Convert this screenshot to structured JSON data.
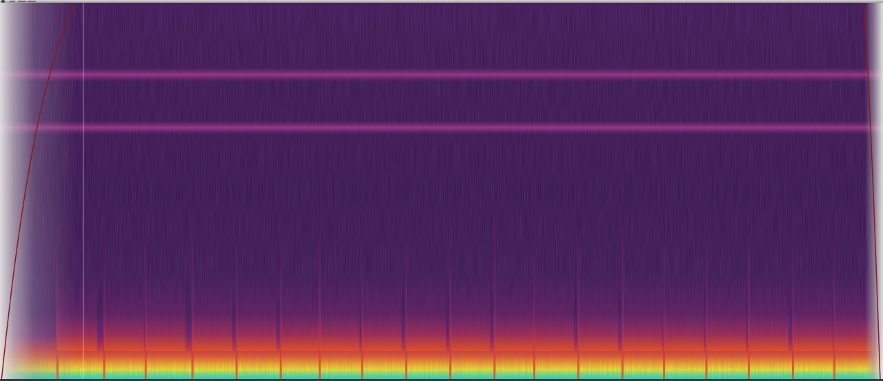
{
  "view": {
    "type": "spectrogram",
    "colormap": [
      "#2a1240",
      "#5a1f6e",
      "#a8306a",
      "#e0502a",
      "#f5b020",
      "#f2f020",
      "#40f0a0",
      "#30c0ff"
    ],
    "accent_curve_color": "#8a1a1a",
    "playhead_color": "#ffe6ff"
  },
  "spectrogram": {
    "note_onsets_fraction": [
      0.065,
      0.118,
      0.165,
      0.218,
      0.268,
      0.318,
      0.362,
      0.41,
      0.46,
      0.51,
      0.56,
      0.605,
      0.655,
      0.705,
      0.752,
      0.8,
      0.848,
      0.898,
      0.945
    ],
    "harmonic_bands_fraction": [
      0.19,
      0.33
    ],
    "playhead_fraction": 0.094
  }
}
